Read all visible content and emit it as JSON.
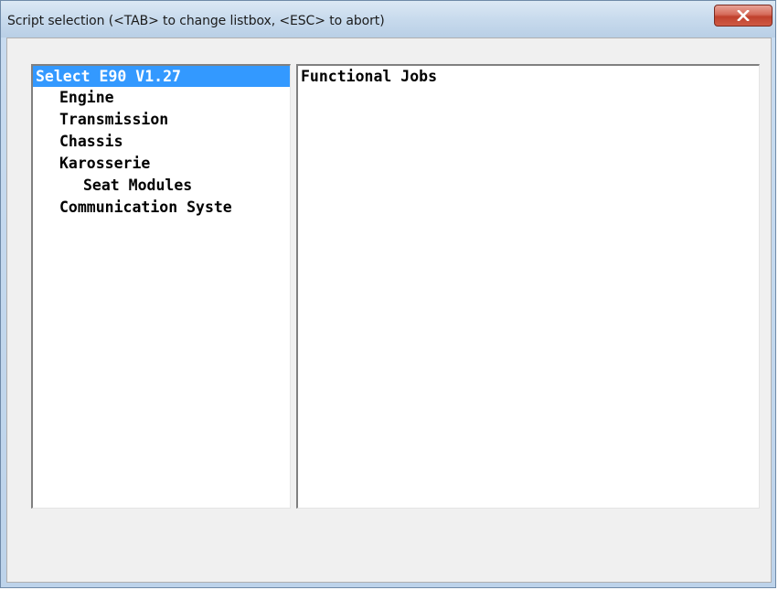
{
  "window": {
    "title": "Script selection  (<TAB> to change listbox, <ESC> to abort)"
  },
  "script_list": {
    "items": [
      {
        "label": "Select E90 V1.27",
        "selected": true
      },
      {
        "label": "Engine",
        "selected": false
      },
      {
        "label": "Transmission",
        "selected": false
      },
      {
        "label": "Chassis",
        "selected": false
      },
      {
        "label": "Karosserie",
        "selected": false
      },
      {
        "label": "Seat Modules",
        "selected": false
      },
      {
        "label": "Communication Syste",
        "selected": false
      }
    ]
  },
  "job_list": {
    "items": [
      {
        "label": "Functional Jobs"
      }
    ]
  },
  "colors": {
    "selection": "#3399ff",
    "close_button": "#c0412d"
  },
  "icons": {
    "close": "close-icon"
  }
}
